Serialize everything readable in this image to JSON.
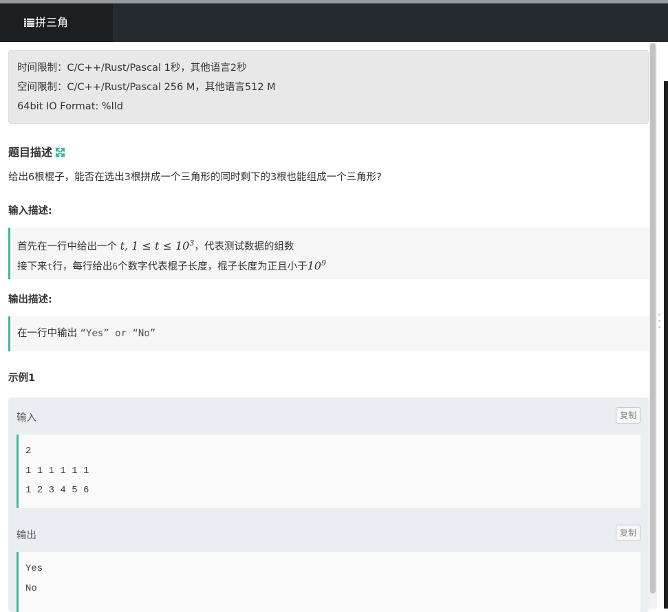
{
  "navbar": {
    "tab_title": "拼三角",
    "tab_icon": "list-icon"
  },
  "limits": {
    "time": "时间限制：C/C++/Rust/Pascal 1秒，其他语言2秒",
    "space": "空间限制：C/C++/Rust/Pascal 256 M，其他语言512 M",
    "format": "64bit IO Format: %lld"
  },
  "problem": {
    "title": "题目描述",
    "expand_icon": "expand-icon",
    "description": "给出6根棍子，能否在选出3根拼成一个三角形的同时剩下的3根也能组成一个三角形?"
  },
  "input": {
    "title": "输入描述:",
    "line1_prefix": "首先在一行中给出一个 ",
    "line1_math": "t, 1 ≤ t ≤ 10",
    "line1_exp": "3",
    "line1_suffix": "，代表测试数据的组数",
    "line2_a": "接下来",
    "line2_t": "t",
    "line2_b": "行，每行给出",
    "line2_six": "6",
    "line2_c": "个数字代表棍子长度，棍子长度为正且小于",
    "line2_math": "10",
    "line2_exp": "9"
  },
  "output": {
    "title": "输出描述:",
    "text_prefix": "在一行中输出 ",
    "text_code": "“Yes” or “No”"
  },
  "example": {
    "title": "示例1",
    "input_label": "输入",
    "output_label": "输出",
    "copy_label": "复制",
    "input_lines": [
      "2",
      "1 1 1 1 1 1",
      "1 2 3 4 5 6"
    ],
    "output_lines": [
      "Yes",
      "No"
    ]
  },
  "colors": {
    "accent": "#39b9a1",
    "navbar": "#252a2e"
  }
}
